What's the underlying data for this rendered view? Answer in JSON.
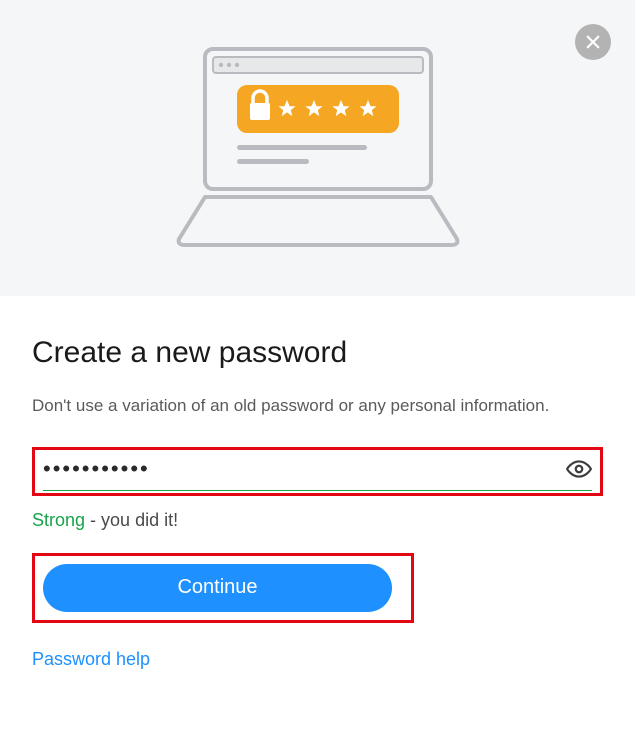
{
  "header": {
    "close_icon": "close"
  },
  "main": {
    "title": "Create a new password",
    "subtitle": "Don't use a variation of an old password or any personal information.",
    "password_mask": "•••••••••••",
    "strength": {
      "label": "Strong",
      "suffix": " - you did it!"
    },
    "continue_label": "Continue",
    "help_link_label": "Password help"
  }
}
